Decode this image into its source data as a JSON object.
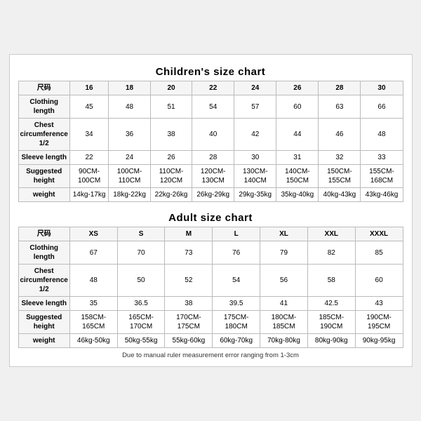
{
  "children_title": "Children's size chart",
  "adult_title": "Adult size chart",
  "note": "Due to manual ruler measurement error ranging from 1-3cm",
  "children": {
    "headers": [
      "尺码",
      "16",
      "18",
      "20",
      "22",
      "24",
      "26",
      "28",
      "30"
    ],
    "rows": [
      {
        "label": "Clothing length",
        "values": [
          "45",
          "48",
          "51",
          "54",
          "57",
          "60",
          "63",
          "66"
        ]
      },
      {
        "label": "Chest circumference 1/2",
        "values": [
          "34",
          "36",
          "38",
          "40",
          "42",
          "44",
          "46",
          "48"
        ]
      },
      {
        "label": "Sleeve length",
        "values": [
          "22",
          "24",
          "26",
          "28",
          "30",
          "31",
          "32",
          "33"
        ]
      },
      {
        "label": "Suggested height",
        "values": [
          "90CM-100CM",
          "100CM-110CM",
          "110CM-120CM",
          "120CM-130CM",
          "130CM-140CM",
          "140CM-150CM",
          "150CM-155CM",
          "155CM-168CM"
        ]
      },
      {
        "label": "weight",
        "values": [
          "14kg-17kg",
          "18kg-22kg",
          "22kg-26kg",
          "26kg-29kg",
          "29kg-35kg",
          "35kg-40kg",
          "40kg-43kg",
          "43kg-46kg"
        ]
      }
    ]
  },
  "adult": {
    "headers": [
      "尺码",
      "XS",
      "S",
      "M",
      "L",
      "XL",
      "XXL",
      "XXXL"
    ],
    "rows": [
      {
        "label": "Clothing length",
        "values": [
          "67",
          "70",
          "73",
          "76",
          "79",
          "82",
          "85"
        ]
      },
      {
        "label": "Chest circumference 1/2",
        "values": [
          "48",
          "50",
          "52",
          "54",
          "56",
          "58",
          "60"
        ]
      },
      {
        "label": "Sleeve length",
        "values": [
          "35",
          "36.5",
          "38",
          "39.5",
          "41",
          "42.5",
          "43"
        ]
      },
      {
        "label": "Suggested height",
        "values": [
          "158CM-165CM",
          "165CM-170CM",
          "170CM-175CM",
          "175CM-180CM",
          "180CM-185CM",
          "185CM-190CM",
          "190CM-195CM"
        ]
      },
      {
        "label": "weight",
        "values": [
          "46kg-50kg",
          "50kg-55kg",
          "55kg-60kg",
          "60kg-70kg",
          "70kg-80kg",
          "80kg-90kg",
          "90kg-95kg"
        ]
      }
    ]
  }
}
